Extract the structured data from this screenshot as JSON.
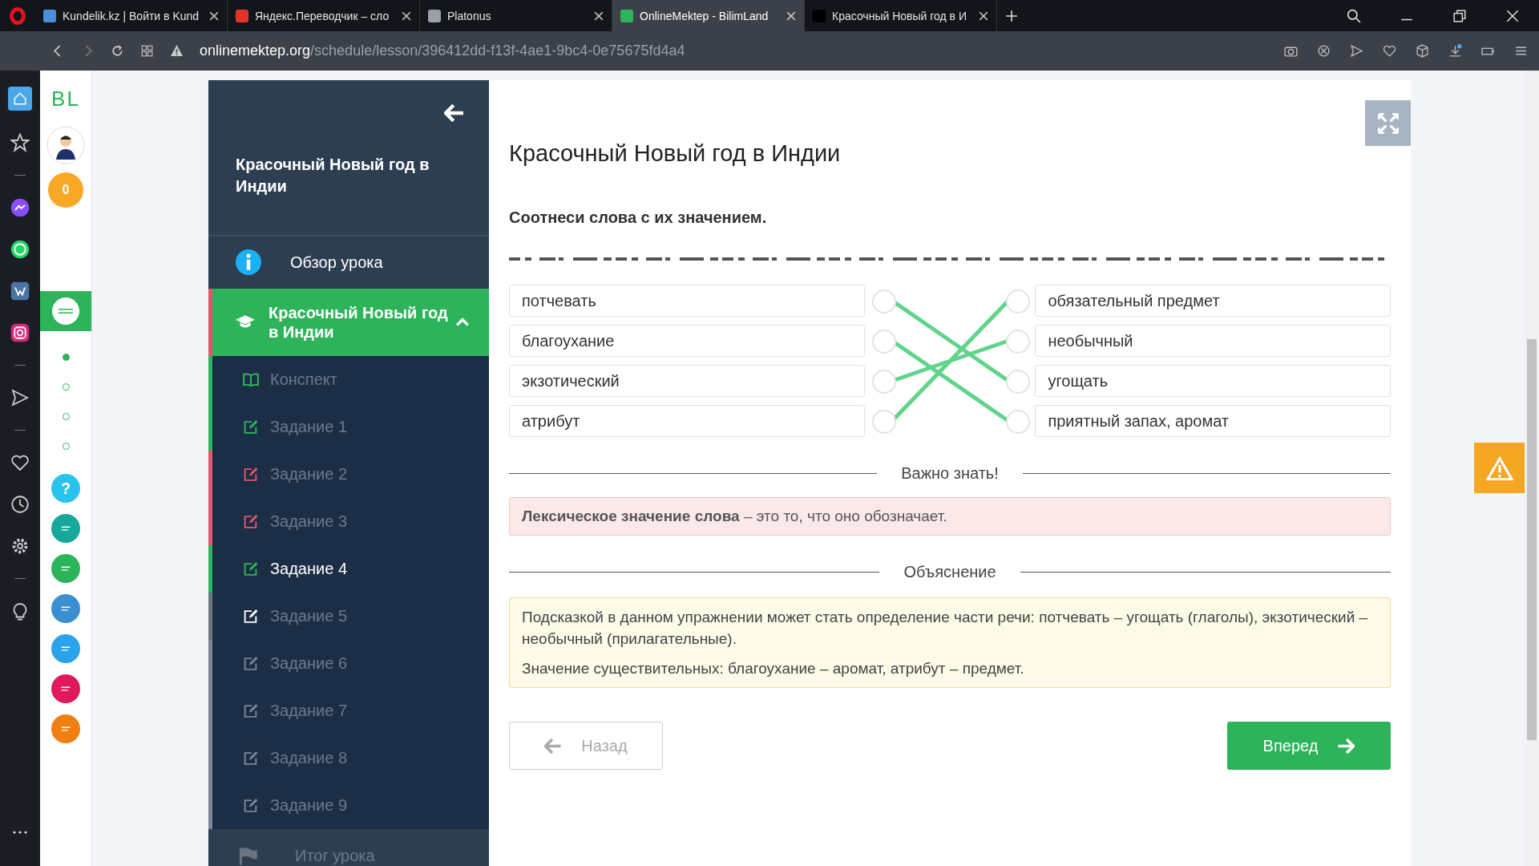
{
  "browser": {
    "tabs": [
      {
        "title": "Kundelik.kz | Войти в Kund",
        "selected": false
      },
      {
        "title": "Яндекс.Переводчик – сло",
        "selected": false
      },
      {
        "title": "Platonus",
        "selected": false
      },
      {
        "title": "OnlineMektep - BilimLand",
        "selected": true
      },
      {
        "title": "Красочный Новый год в И",
        "selected": false
      }
    ],
    "url": {
      "host": "onlinemektep.org",
      "path": "/schedule/lesson/396412dd-f13f-4ae1-9bc4-0e75675fd4a4"
    }
  },
  "app_sidebar": {
    "logo": "BL",
    "points": "0",
    "nav_dots": [
      {
        "selected": true
      },
      {
        "selected": false
      },
      {
        "selected": false
      },
      {
        "selected": false
      }
    ],
    "apps": [
      {
        "kind": "help",
        "glyph": "?",
        "color": "#29c4ee"
      },
      {
        "kind": "logo",
        "color": "#16a89a"
      },
      {
        "kind": "logo",
        "color": "#2db45a"
      },
      {
        "kind": "logo",
        "color": "#3b8fd0"
      },
      {
        "kind": "logo",
        "color": "#2aa3ea"
      },
      {
        "kind": "logo",
        "color": "#e0195b"
      },
      {
        "kind": "logo",
        "color": "#f07f12"
      }
    ]
  },
  "lesson_nav": {
    "title": "Красочный Новый год в Индии",
    "overview": "Обзор урока",
    "section": {
      "title": "Красочный Новый год в Индии",
      "expanded": true,
      "items": [
        {
          "label": "Конспект",
          "kind": "summary",
          "color": "#2db45a",
          "current": false
        },
        {
          "label": "Задание 1",
          "kind": "task",
          "color": "#2db45a",
          "current": false
        },
        {
          "label": "Задание 2",
          "kind": "task",
          "color": "#e0566b",
          "current": false
        },
        {
          "label": "Задание 3",
          "kind": "task",
          "color": "#e0566b",
          "current": false
        },
        {
          "label": "Задание 4",
          "kind": "task",
          "color": "#2db45a",
          "current": true
        },
        {
          "label": "Задание 5",
          "kind": "task",
          "color": "#ffffff",
          "current": false
        },
        {
          "label": "Задание 6",
          "kind": "task",
          "color": "#7a8696",
          "current": false
        },
        {
          "label": "Задание 7",
          "kind": "task",
          "color": "#7a8696",
          "current": false
        },
        {
          "label": "Задание 8",
          "kind": "task",
          "color": "#7a8696",
          "current": false
        },
        {
          "label": "Задание 9",
          "kind": "task",
          "color": "#7a8696",
          "current": false
        }
      ]
    },
    "footer": "Итог урока"
  },
  "lesson": {
    "title": "Красочный Новый год в Индии",
    "question": "Соотнеси слова с их значением.",
    "matching": {
      "left": [
        {
          "text": "потчевать",
          "linked": [
            false,
            false,
            true,
            false
          ]
        },
        {
          "text": "благоухание",
          "linked": [
            false,
            false,
            false,
            true
          ]
        },
        {
          "text": "экзотический",
          "linked": [
            false,
            true,
            false,
            false
          ]
        },
        {
          "text": "атрибут",
          "linked": [
            true,
            false,
            false,
            false
          ]
        }
      ],
      "right": [
        "обязательный предмет",
        "необычный",
        "угощать",
        "приятный запах, аромат"
      ]
    },
    "note_heading": "Важно знать!",
    "note": "**Лексическое значение слова** – это то, что оно обозначает.",
    "explanation_heading": "Объяснение",
    "explanation": [
      "Подсказкой в данном упражнении может стать определение части речи: потчевать – угощать (глаголы), экзотический – необычный (прилагательные).",
      "Значение существительных: благоухание – аромат, атрибут – предмет."
    ],
    "back": "Назад",
    "next": "Вперед"
  }
}
